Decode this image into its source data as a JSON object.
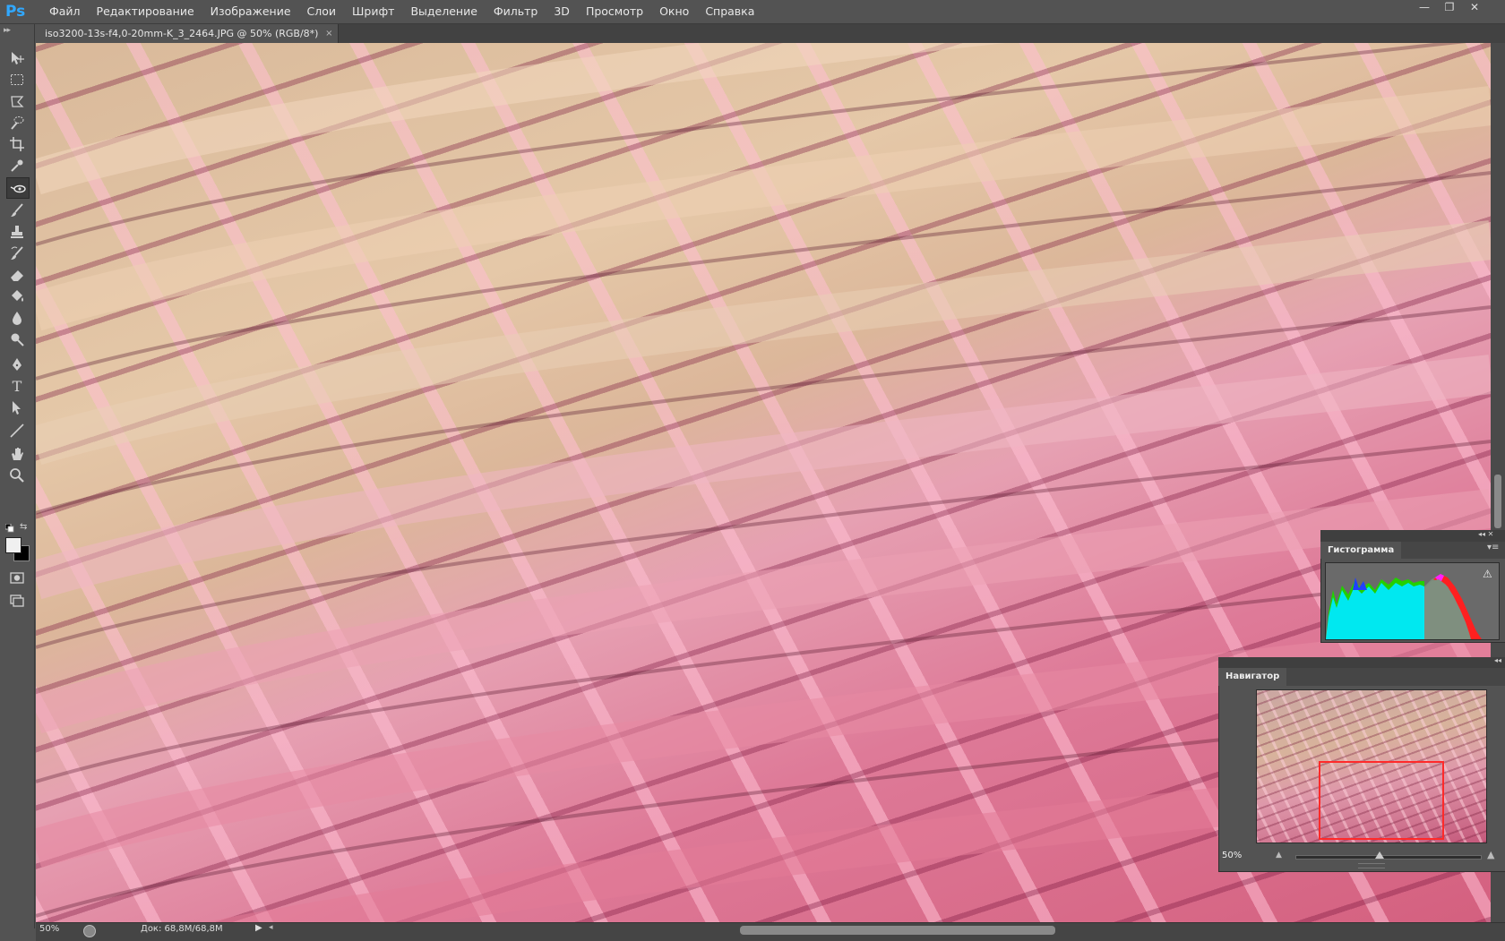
{
  "app": {
    "logo": "Ps"
  },
  "menu": [
    "Файл",
    "Редактирование",
    "Изображение",
    "Слои",
    "Шрифт",
    "Выделение",
    "Фильтр",
    "3D",
    "Просмотр",
    "Окно",
    "Справка"
  ],
  "window_buttons": {
    "minimize": "—",
    "maximize": "❐",
    "close": "✕"
  },
  "document_tab": {
    "title": "iso3200-13s-f4,0-20mm-K_3_2464.JPG @ 50% (RGB/8*)",
    "close": "×"
  },
  "tools": [
    {
      "name": "move-tool",
      "icon": "move-icon"
    },
    {
      "name": "marquee-tool",
      "icon": "marquee-icon"
    },
    {
      "name": "lasso-tool",
      "icon": "lasso-icon"
    },
    {
      "name": "quick-selection-tool",
      "icon": "quick-selection-icon"
    },
    {
      "name": "crop-tool",
      "icon": "crop-icon"
    },
    {
      "name": "eyedropper-tool",
      "icon": "eyedropper-icon"
    },
    {
      "name": "healing-brush-tool",
      "icon": "healing-brush-icon"
    },
    {
      "name": "brush-tool",
      "icon": "brush-icon"
    },
    {
      "name": "clone-stamp-tool",
      "icon": "stamp-icon"
    },
    {
      "name": "history-brush-tool",
      "icon": "history-brush-icon"
    },
    {
      "name": "eraser-tool",
      "icon": "eraser-icon"
    },
    {
      "name": "paint-bucket-tool",
      "icon": "paint-bucket-icon"
    },
    {
      "name": "blur-tool",
      "icon": "blur-drop-icon"
    },
    {
      "name": "dodge-tool",
      "icon": "dodge-icon"
    },
    {
      "name": "pen-tool",
      "icon": "pen-icon"
    },
    {
      "name": "type-tool",
      "icon": "type-icon",
      "glyph": "T"
    },
    {
      "name": "path-selection-tool",
      "icon": "path-selection-icon"
    },
    {
      "name": "line-tool",
      "icon": "line-icon"
    },
    {
      "name": "hand-tool",
      "icon": "hand-icon"
    },
    {
      "name": "zoom-tool",
      "icon": "zoom-icon"
    }
  ],
  "status": {
    "zoom": "50%",
    "doc_size": "Док: 68,8M/68,8M",
    "arrow": "▶",
    "scroll_left": "◂"
  },
  "histogram": {
    "tab": "Гистограмма",
    "warning": "⚠",
    "menu": "▾≡",
    "controls": "◂◂ ✕"
  },
  "navigator": {
    "tab": "Навигатор",
    "zoom": "50%",
    "zoom_out": "▲",
    "zoom_in": "▲",
    "zoom_fraction": 0.45,
    "controls": "◂◂"
  },
  "colors": {
    "ui_bg": "#535353",
    "accent": "#31a8ff",
    "view_rect": "#ff2a2a",
    "foreground": "#f0f0f0",
    "background": "#000000"
  }
}
